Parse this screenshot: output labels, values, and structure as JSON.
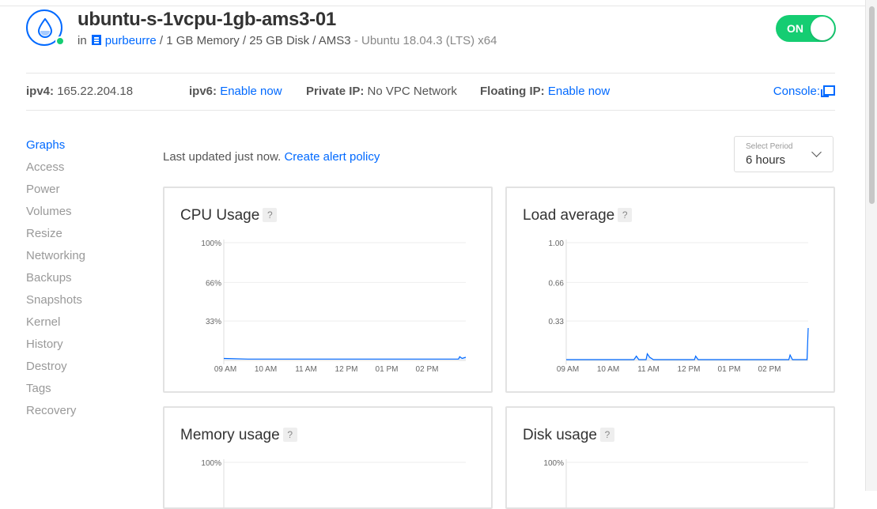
{
  "droplet": {
    "name": "ubuntu-s-1vcpu-1gb-ams3-01",
    "in_label": "in",
    "project": "purbeurre",
    "specs": "/ 1 GB Memory / 25 GB Disk / AMS3",
    "os": "- Ubuntu 18.04.3 (LTS) x64",
    "power_toggle": "ON",
    "status_color": "#15cd72"
  },
  "info": {
    "ipv4_label": "ipv4:",
    "ipv4_value": "165.22.204.18",
    "ipv6_label": "ipv6:",
    "ipv6_link": "Enable now",
    "private_ip_label": "Private IP:",
    "private_ip_value": "No VPC Network",
    "floating_ip_label": "Floating IP:",
    "floating_ip_link": "Enable now",
    "console_label": "Console:"
  },
  "nav": [
    "Graphs",
    "Access",
    "Power",
    "Volumes",
    "Resize",
    "Networking",
    "Backups",
    "Snapshots",
    "Kernel",
    "History",
    "Destroy",
    "Tags",
    "Recovery"
  ],
  "nav_active": "Graphs",
  "graphs": {
    "last_updated": "Last updated just now.",
    "alert_link": "Create alert policy",
    "period_label": "Select Period",
    "period_value": "6 hours",
    "help_icon": "?"
  },
  "accent_color": "#0069ff",
  "charts": [
    {
      "title": "CPU Usage",
      "y_ticks": [
        "100%",
        "66%",
        "33%"
      ],
      "y_values": [
        1.0,
        0.66,
        0.33
      ],
      "x_ticks": [
        "09 AM",
        "10 AM",
        "11 AM",
        "12 PM",
        "01 PM",
        "02 PM"
      ],
      "series": [
        [
          0,
          0.01
        ],
        [
          0.1,
          0.005
        ],
        [
          0.3,
          0.005
        ],
        [
          0.5,
          0.005
        ],
        [
          0.7,
          0.005
        ],
        [
          0.85,
          0.005
        ],
        [
          0.97,
          0.005
        ],
        [
          0.975,
          0.025
        ],
        [
          0.985,
          0.01
        ],
        [
          1,
          0.02
        ]
      ],
      "ymax": 1
    },
    {
      "title": "Load average",
      "y_ticks": [
        "1.00",
        "0.66",
        "0.33"
      ],
      "y_values": [
        1.0,
        0.66,
        0.33
      ],
      "x_ticks": [
        "09 AM",
        "10 AM",
        "11 AM",
        "12 PM",
        "01 PM",
        "02 PM"
      ],
      "series": [
        [
          0,
          0
        ],
        [
          0.28,
          0
        ],
        [
          0.29,
          0.03
        ],
        [
          0.3,
          0
        ],
        [
          0.33,
          0
        ],
        [
          0.335,
          0.05
        ],
        [
          0.345,
          0.02
        ],
        [
          0.36,
          0
        ],
        [
          0.53,
          0
        ],
        [
          0.535,
          0.03
        ],
        [
          0.545,
          0
        ],
        [
          0.92,
          0
        ],
        [
          0.925,
          0.04
        ],
        [
          0.935,
          0
        ],
        [
          0.995,
          0
        ],
        [
          1,
          0.27
        ]
      ],
      "ymax": 1
    },
    {
      "title": "Memory usage",
      "y_ticks": [
        "100%"
      ],
      "y_values": [
        1.0
      ],
      "x_ticks": [],
      "series": [],
      "ymax": 1
    },
    {
      "title": "Disk usage",
      "y_ticks": [
        "100%"
      ],
      "y_values": [
        1.0
      ],
      "x_ticks": [],
      "series": [],
      "ymax": 1
    }
  ]
}
